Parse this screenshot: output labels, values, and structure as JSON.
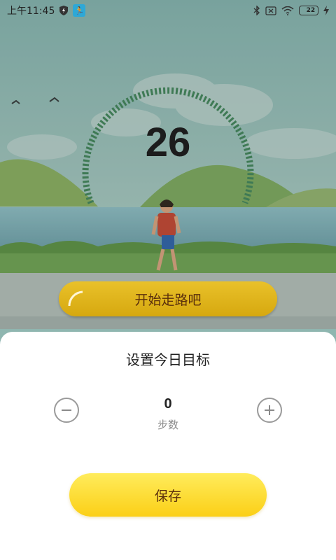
{
  "status_bar": {
    "time": "上午11:45",
    "battery_level": "22",
    "icons": [
      "shield-icon",
      "runner-app-icon",
      "bluetooth-icon",
      "no-sim-icon",
      "wifi-icon",
      "battery-icon",
      "charging-icon"
    ]
  },
  "walk": {
    "current_steps": "26",
    "start_label": "开始走路吧"
  },
  "goal_sheet": {
    "title": "设置今日目标",
    "value": "0",
    "unit": "步数",
    "save_label": "保存"
  },
  "colors": {
    "accent_yellow": "#fbcf16",
    "walk_button": "#d6a80f",
    "button_text": "#5a2f0c",
    "gauge_green": "#3f7a55"
  }
}
